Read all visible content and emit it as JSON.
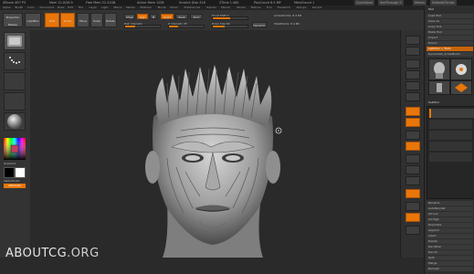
{
  "titlebar": {
    "app": "ZBrush 4R7 P3",
    "segments": [
      "Mem 12.0/26.9",
      "Free Mem 22.31GB",
      "Active Mem 1258",
      "Scratch Disk 418",
      "ZTime 1.484",
      "PolyCount 8.4 MP",
      "MeshCount 1"
    ],
    "right_items": [
      "QuickSave",
      "SeeThrough 0",
      "Menus",
      "DefaultZScript"
    ]
  },
  "menubar": {
    "items": [
      "Alpha",
      "Brush",
      "Color",
      "Document",
      "Draw",
      "Edit",
      "File",
      "Layer",
      "Light",
      "Macro",
      "Marker",
      "Material",
      "Movie",
      "Picker",
      "Preferences",
      "Render",
      "Stencil",
      "Stroke",
      "Texture",
      "Tool",
      "Transform",
      "Zplugin",
      "Zscript"
    ]
  },
  "toolbar": {
    "projection_master": "Projection Master",
    "lightbox": "LightBox",
    "edit": "Edit",
    "draw": "Draw",
    "move": "Move",
    "scale": "Scale",
    "rotate": "Rotate",
    "mrgb": "Mrgb",
    "rgb": "Rgb",
    "m": "M",
    "zadd": "Zadd",
    "zsub": "Zsub",
    "zcut": "Zcut",
    "rgb_intensity": "Rgb Intensity",
    "z_intensity": "Z Intensity 25",
    "focal_shift": "Focal Shift 0",
    "draw_size": "Draw Size 64",
    "dynamic": "Dynamic",
    "active_points": "ActivePoints: 8.4 Mil",
    "total_points": "TotalPoints: 8.4 Mil"
  },
  "left_shelf": {
    "gradient_label": "Gradient",
    "switch_color": "SwitchColor",
    "alternate": "Alternate"
  },
  "tray": {
    "title": "Tool",
    "rows": [
      "Load Tool",
      "Save As",
      "Copy Tool",
      "Paste Tool",
      "Import",
      "Export",
      "Clone",
      "Make PolyMesh3D",
      "GoZ",
      "All",
      "Visible",
      "R",
      "Lightbox > Tools",
      "Dynamesh_ScalpModel"
    ],
    "subtools_title": "SubTool",
    "subtool_rows": [
      "Rename",
      "AutoReorder",
      "All Low",
      "All High",
      "Duplicate",
      "Append",
      "Insert",
      "Delete",
      "Del Other",
      "Del All",
      "Split",
      "Merge",
      "Remesh",
      "Project",
      "Extract"
    ]
  },
  "watermark": {
    "text": "ABOUTCG",
    "suffix": ".ORG"
  },
  "colors": {
    "accent": "#e8760a",
    "bg": "#2a2a2a",
    "panel": "#333333"
  },
  "icons": {
    "cursor": "crosshair-cursor-icon",
    "sculpt": "bust-sculpt"
  },
  "sliders": {
    "z_intensity": 25,
    "draw_size": 64
  }
}
